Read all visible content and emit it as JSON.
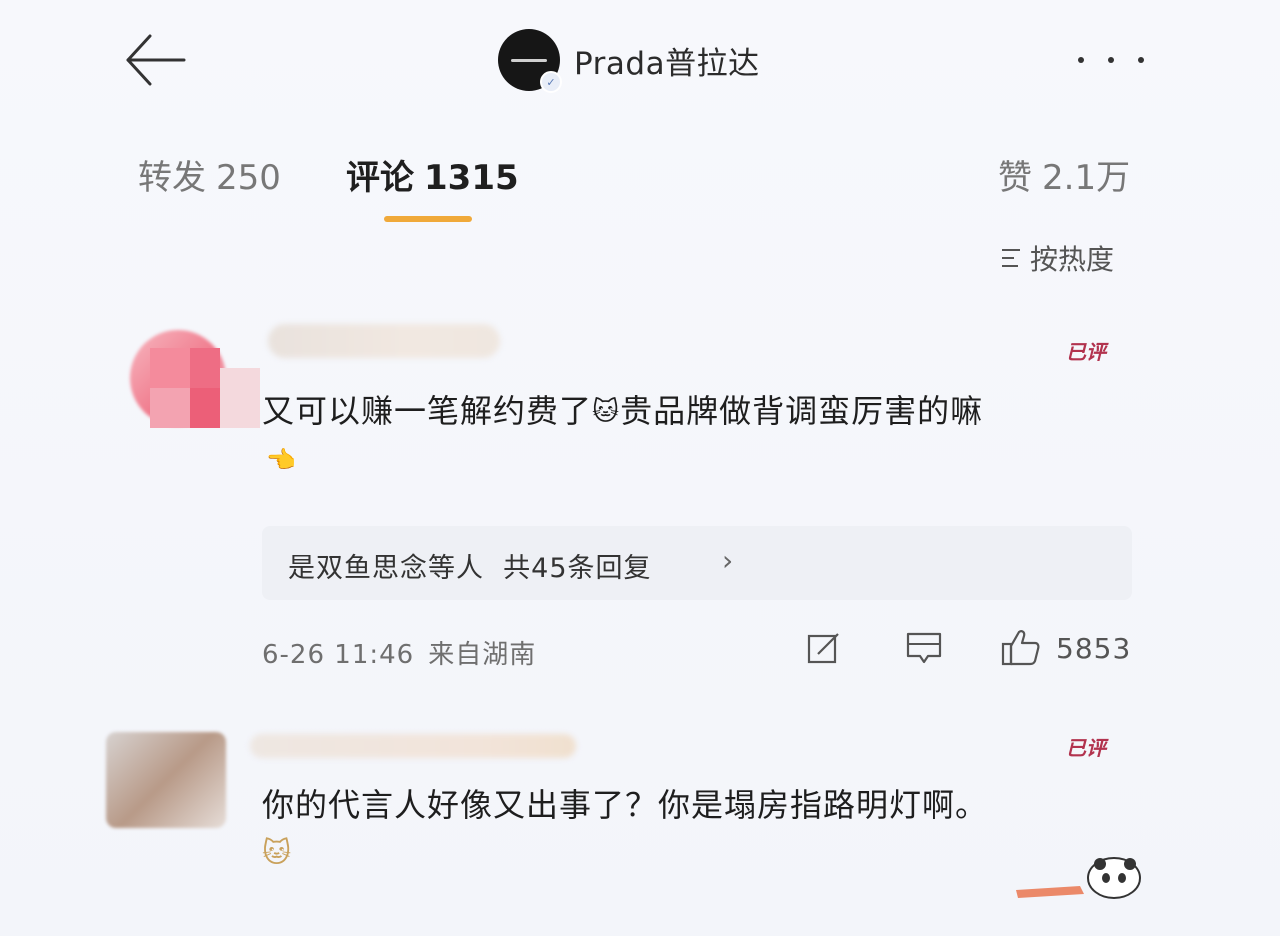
{
  "header": {
    "account_name": "Prada普拉达",
    "back_icon": "arrow-left-icon",
    "more_icon": "ellipsis-icon"
  },
  "tabs": {
    "repost": {
      "label": "转发",
      "count": "250"
    },
    "comments": {
      "label": "评论",
      "count": "1315"
    },
    "likes": {
      "label": "赞",
      "count": "2.1万"
    }
  },
  "sort": {
    "label": "按热度"
  },
  "comments": [
    {
      "badge": "已评",
      "text_before_emoji": "又可以赚一笔解约费了",
      "emoji": "🐱",
      "text_after_emoji": "贵品牌做背调蛮厉害的嘛",
      "trail_emoji": "👈",
      "replies": {
        "label": "是双鱼思念等人",
        "count_text": "共45条回复",
        "chevron": "›"
      },
      "time": "6-26 11:46",
      "location": "来自湖南",
      "likes": "5853"
    },
    {
      "badge": "已评",
      "text": "你的代言人好像又出事了？你是塌房指路明灯啊。",
      "trail_emoji": "🐱"
    }
  ],
  "colors": {
    "accent": "#f0a93a",
    "badge": "#b2334e",
    "background": "#f6f7fb"
  }
}
